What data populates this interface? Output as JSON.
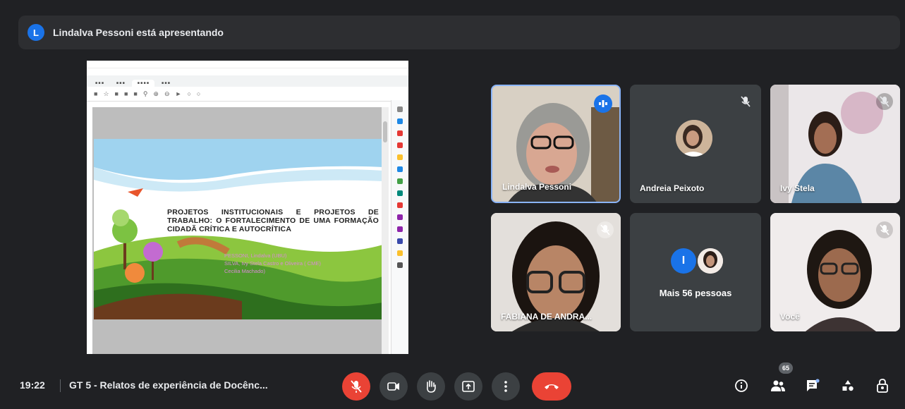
{
  "banner": {
    "avatar_initial": "L",
    "text": "Lindalva Pessoni está apresentando"
  },
  "shared_screen": {
    "slide_title": "PROJETOS INSTITUCIONAIS E PROJETOS DE TRABALHO: O FORTALECIMENTO DE UMA FORMAÇÃO CIDADÃ CRÍTICA E AUTOCRÍTICA",
    "slide_authors": [
      "PESSONI, Lindalva (UBU)",
      "SILVA,  Ivy Stela Castro e Oliveira ( CME)",
      "Cecilia Machado)"
    ]
  },
  "participants": [
    {
      "name": "Lindalva Pessoni",
      "status": "speaking",
      "accent": "#1a73e8"
    },
    {
      "name": "Andreia Peixoto",
      "status": "muted"
    },
    {
      "name": "Ivy Stela",
      "status": "muted"
    },
    {
      "name": "FABIANA DE ANDRA...",
      "status": "muted"
    },
    {
      "name": "Mais 56 pessoas",
      "avatar_initial": "I",
      "status": "group"
    },
    {
      "name": "Você",
      "status": "muted"
    }
  ],
  "bottom_bar": {
    "time": "19:22",
    "meeting_title": "GT 5 - Relatos de experiência de Docênc...",
    "people_count": "65",
    "controls": [
      "mic-off",
      "camera",
      "raise-hand",
      "present",
      "more",
      "end-call"
    ],
    "right_icons": [
      "info",
      "people",
      "chat",
      "activities",
      "host-controls"
    ]
  },
  "colors": {
    "background": "#202124",
    "danger": "#ea4335",
    "accent": "#1a73e8"
  }
}
